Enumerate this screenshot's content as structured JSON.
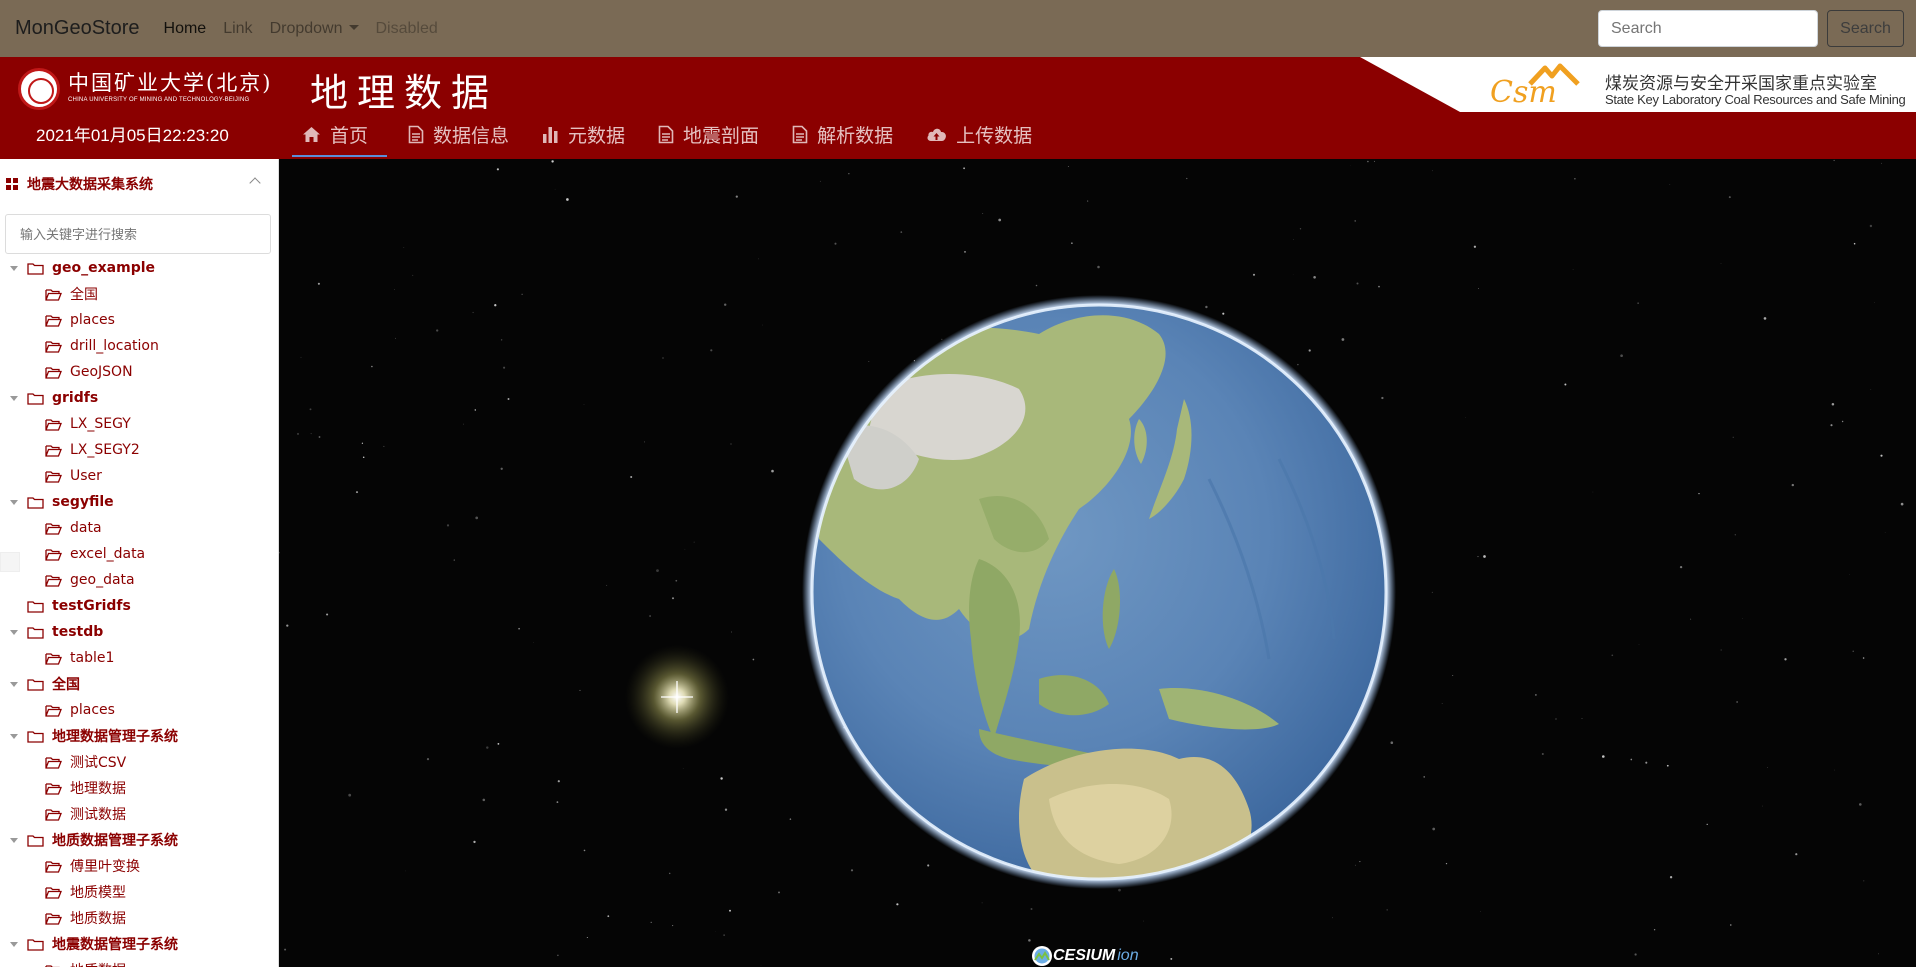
{
  "navbar": {
    "brand": "MonGeoStore",
    "links": [
      {
        "label": "Home",
        "state": "active"
      },
      {
        "label": "Link",
        "state": "normal"
      },
      {
        "label": "Dropdown",
        "state": "dropdown"
      },
      {
        "label": "Disabled",
        "state": "disabled"
      }
    ],
    "search_placeholder": "Search",
    "search_button": "Search"
  },
  "header": {
    "university_name": "中国矿业大学(北京)",
    "university_sub": "CHINA UNIVERSITY OF MINING AND TECHNOLOGY-BEIJING",
    "datetime": "2021年01月05日22:23:20",
    "title": "地理数据",
    "tabs": [
      {
        "label": "首页",
        "icon": "home-icon",
        "active": true
      },
      {
        "label": "数据信息",
        "icon": "document-icon",
        "active": false
      },
      {
        "label": "元数据",
        "icon": "bar-chart-icon",
        "active": false
      },
      {
        "label": "地震剖面",
        "icon": "document-icon",
        "active": false
      },
      {
        "label": "解析数据",
        "icon": "document-icon",
        "active": false
      },
      {
        "label": "上传数据",
        "icon": "cloud-upload-icon",
        "active": false
      }
    ],
    "lab_logo_text": "Csm",
    "lab_name_cn": "煤炭资源与安全开采国家重点实验室",
    "lab_name_en": "State Key Laboratory Coal Resources and Safe Mining"
  },
  "sidebar": {
    "title": "地震大数据采集系统",
    "search_placeholder": "输入关键字进行搜索",
    "tree": [
      {
        "label": "geo_example",
        "children": [
          "全国",
          "places",
          "drill_location",
          "GeoJSON"
        ]
      },
      {
        "label": "gridfs",
        "children": [
          "LX_SEGY",
          "LX_SEGY2",
          "User"
        ]
      },
      {
        "label": "segyfile",
        "children": [
          "data",
          "excel_data",
          "geo_data"
        ]
      },
      {
        "label": "testGridfs",
        "children": []
      },
      {
        "label": "testdb",
        "children": [
          "table1"
        ]
      },
      {
        "label": "全国",
        "children": [
          "places"
        ]
      },
      {
        "label": "地理数据管理子系统",
        "children": [
          "测试CSV",
          "地理数据",
          "测试数据"
        ]
      },
      {
        "label": "地质数据管理子系统",
        "children": [
          "傅里叶变换",
          "地质模型",
          "地质数据"
        ]
      },
      {
        "label": "地震数据管理子系统",
        "children": [
          "地质数据"
        ]
      }
    ]
  },
  "viewer": {
    "credit_brand": "CESIUM",
    "credit_suffix": "ion"
  },
  "colors": {
    "navbar_bg": "#7a6a55",
    "header_red": "#8b0000",
    "tab_active_underline": "#5a8fd8",
    "tree_text": "#8b0000",
    "lab_logo": "#f0a020"
  }
}
